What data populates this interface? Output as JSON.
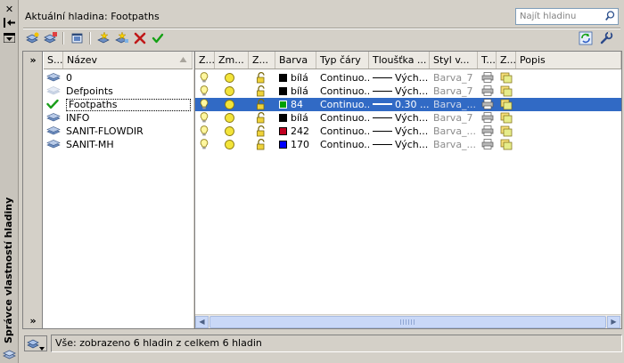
{
  "window": {
    "title_vertical": "Správce vlastností hladiny",
    "close_glyph": "✕"
  },
  "header": {
    "current_layer_label": "Aktuální hladina: Footpaths",
    "search_placeholder": "Najít hladinu"
  },
  "left_list": {
    "headers": {
      "status": "S...",
      "name": "Název"
    },
    "items": [
      {
        "name": "0",
        "icon": "layer-stack-icon",
        "selected": false
      },
      {
        "name": "Defpoints",
        "icon": "layer-stack-icon",
        "selected": false
      },
      {
        "name": "Footpaths",
        "icon": "current-check-icon",
        "selected": true
      },
      {
        "name": "INFO",
        "icon": "layer-stack-icon",
        "selected": false
      },
      {
        "name": "SANIT-FLOWDIR",
        "icon": "layer-stack-icon",
        "selected": false
      },
      {
        "name": "SANIT-MH",
        "icon": "layer-stack-icon",
        "selected": false
      }
    ]
  },
  "grid": {
    "headers": [
      "Z...",
      "Zm...",
      "Z...",
      "Barva",
      "Typ čáry",
      "Tloušťka ...",
      "Styl v...",
      "T...",
      "Z...",
      "Popis"
    ],
    "rows": [
      {
        "color_hex": "#000000",
        "color_name": "bílá",
        "linetype": "Continuo...",
        "lineweight": "Vých...",
        "plotstyle": "Barva_7",
        "selected": false
      },
      {
        "color_hex": "#000000",
        "color_name": "bílá",
        "linetype": "Continuo...",
        "lineweight": "Vých...",
        "plotstyle": "Barva_7",
        "selected": false
      },
      {
        "color_hex": "#00a000",
        "color_name": "84",
        "linetype": "Continuo...",
        "lineweight": "0.30 ...",
        "plotstyle": "Barva_...",
        "selected": true
      },
      {
        "color_hex": "#000000",
        "color_name": "bílá",
        "linetype": "Continuo...",
        "lineweight": "Vých...",
        "plotstyle": "Barva_7",
        "selected": false
      },
      {
        "color_hex": "#c00020",
        "color_name": "242",
        "linetype": "Continuo...",
        "lineweight": "Vých...",
        "plotstyle": "Barva_...",
        "selected": false
      },
      {
        "color_hex": "#0000ff",
        "color_name": "170",
        "linetype": "Continuo...",
        "lineweight": "Vých...",
        "plotstyle": "Barva_...",
        "selected": false
      }
    ]
  },
  "status": {
    "text": "Vše: zobrazeno 6 hladin z celkem 6 hladin"
  },
  "colors": {
    "selection": "#316ac5",
    "panel": "#d4d0c8"
  }
}
